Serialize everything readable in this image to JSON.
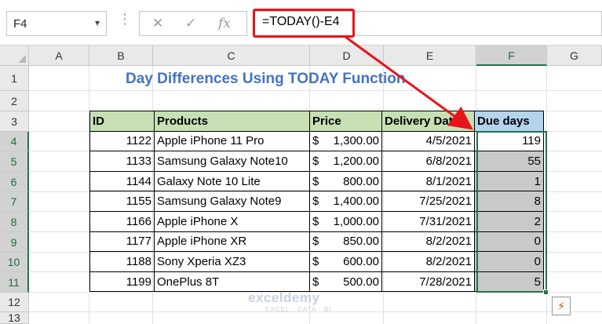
{
  "formula_bar": {
    "name_box": "F4",
    "name_box_arrow": "▾",
    "dots": "⋮",
    "cancel_glyph": "✕",
    "enter_glyph": "✓",
    "fx_glyph": "fx",
    "formula": "=TODAY()-E4"
  },
  "columns": [
    "A",
    "B",
    "C",
    "D",
    "E",
    "F",
    "G"
  ],
  "rows": [
    "1",
    "2",
    "3",
    "4",
    "5",
    "6",
    "7",
    "8",
    "9",
    "10",
    "11",
    "12",
    "13"
  ],
  "sheet": {
    "title": "Day Differences Using TODAY Function",
    "headers": {
      "id": "ID",
      "products": "Products",
      "price": "Price",
      "delivery": "Delivery Date",
      "due": "Due days"
    },
    "records": [
      {
        "id": "1122",
        "product": "Apple iPhone 11 Pro",
        "price_sign": "$",
        "price": "1,300.00",
        "date": "4/5/2021",
        "due": "119"
      },
      {
        "id": "1133",
        "product": "Samsung Galaxy Note10",
        "price_sign": "$",
        "price": "1,200.00",
        "date": "6/8/2021",
        "due": "55"
      },
      {
        "id": "1144",
        "product": "Galaxy Note 10 Lite",
        "price_sign": "$",
        "price": "800.00",
        "date": "8/1/2021",
        "due": "1"
      },
      {
        "id": "1155",
        "product": "Samsung Galaxy Note9",
        "price_sign": "$",
        "price": "1,400.00",
        "date": "7/25/2021",
        "due": "8"
      },
      {
        "id": "1166",
        "product": "Apple iPhone X",
        "price_sign": "$",
        "price": "1,000.00",
        "date": "7/31/2021",
        "due": "2"
      },
      {
        "id": "1177",
        "product": "Apple iPhone XR",
        "price_sign": "$",
        "price": "850.00",
        "date": "8/2/2021",
        "due": "0"
      },
      {
        "id": "1188",
        "product": "Sony Xperia XZ3",
        "price_sign": "$",
        "price": "600.00",
        "date": "8/2/2021",
        "due": "0"
      },
      {
        "id": "1199",
        "product": "OnePlus 8T",
        "price_sign": "$",
        "price": "500.00",
        "date": "7/28/2021",
        "due": "5"
      }
    ]
  },
  "watermark": {
    "name": "exceldemy",
    "tagline": "EXCEL · DATA · BI"
  },
  "quick_analysis_glyph": "⚡",
  "colors": {
    "title": "#4472c4",
    "header_green": "#c6e0b4",
    "header_blue": "#b4d3ed",
    "selection": "#217346",
    "highlight": "#e8141b"
  }
}
